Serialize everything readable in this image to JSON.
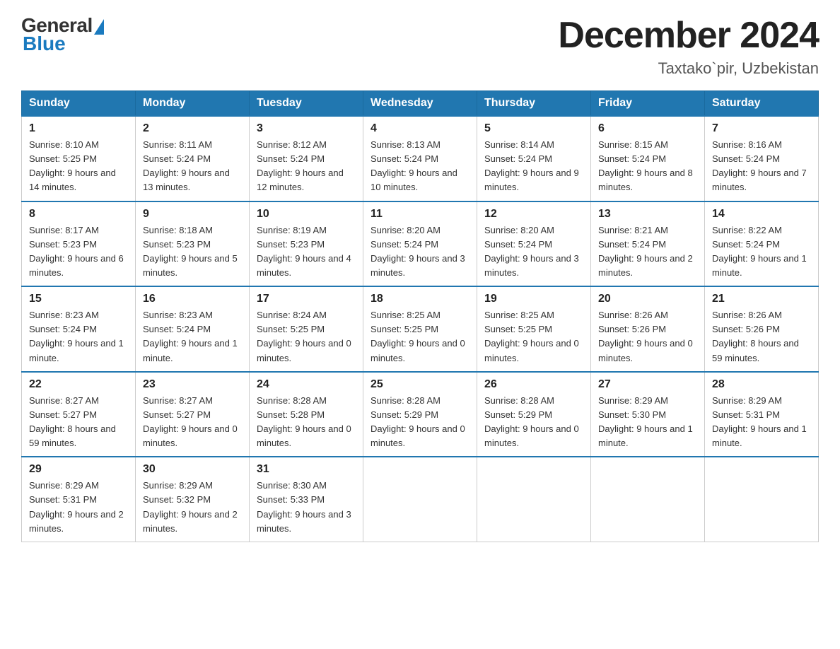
{
  "logo": {
    "general": "General",
    "blue": "Blue"
  },
  "title": "December 2024",
  "location": "Taxtako`pir, Uzbekistan",
  "days_of_week": [
    "Sunday",
    "Monday",
    "Tuesday",
    "Wednesday",
    "Thursday",
    "Friday",
    "Saturday"
  ],
  "weeks": [
    [
      {
        "day": "1",
        "sunrise": "8:10 AM",
        "sunset": "5:25 PM",
        "daylight": "9 hours and 14 minutes."
      },
      {
        "day": "2",
        "sunrise": "8:11 AM",
        "sunset": "5:24 PM",
        "daylight": "9 hours and 13 minutes."
      },
      {
        "day": "3",
        "sunrise": "8:12 AM",
        "sunset": "5:24 PM",
        "daylight": "9 hours and 12 minutes."
      },
      {
        "day": "4",
        "sunrise": "8:13 AM",
        "sunset": "5:24 PM",
        "daylight": "9 hours and 10 minutes."
      },
      {
        "day": "5",
        "sunrise": "8:14 AM",
        "sunset": "5:24 PM",
        "daylight": "9 hours and 9 minutes."
      },
      {
        "day": "6",
        "sunrise": "8:15 AM",
        "sunset": "5:24 PM",
        "daylight": "9 hours and 8 minutes."
      },
      {
        "day": "7",
        "sunrise": "8:16 AM",
        "sunset": "5:24 PM",
        "daylight": "9 hours and 7 minutes."
      }
    ],
    [
      {
        "day": "8",
        "sunrise": "8:17 AM",
        "sunset": "5:23 PM",
        "daylight": "9 hours and 6 minutes."
      },
      {
        "day": "9",
        "sunrise": "8:18 AM",
        "sunset": "5:23 PM",
        "daylight": "9 hours and 5 minutes."
      },
      {
        "day": "10",
        "sunrise": "8:19 AM",
        "sunset": "5:23 PM",
        "daylight": "9 hours and 4 minutes."
      },
      {
        "day": "11",
        "sunrise": "8:20 AM",
        "sunset": "5:24 PM",
        "daylight": "9 hours and 3 minutes."
      },
      {
        "day": "12",
        "sunrise": "8:20 AM",
        "sunset": "5:24 PM",
        "daylight": "9 hours and 3 minutes."
      },
      {
        "day": "13",
        "sunrise": "8:21 AM",
        "sunset": "5:24 PM",
        "daylight": "9 hours and 2 minutes."
      },
      {
        "day": "14",
        "sunrise": "8:22 AM",
        "sunset": "5:24 PM",
        "daylight": "9 hours and 1 minute."
      }
    ],
    [
      {
        "day": "15",
        "sunrise": "8:23 AM",
        "sunset": "5:24 PM",
        "daylight": "9 hours and 1 minute."
      },
      {
        "day": "16",
        "sunrise": "8:23 AM",
        "sunset": "5:24 PM",
        "daylight": "9 hours and 1 minute."
      },
      {
        "day": "17",
        "sunrise": "8:24 AM",
        "sunset": "5:25 PM",
        "daylight": "9 hours and 0 minutes."
      },
      {
        "day": "18",
        "sunrise": "8:25 AM",
        "sunset": "5:25 PM",
        "daylight": "9 hours and 0 minutes."
      },
      {
        "day": "19",
        "sunrise": "8:25 AM",
        "sunset": "5:25 PM",
        "daylight": "9 hours and 0 minutes."
      },
      {
        "day": "20",
        "sunrise": "8:26 AM",
        "sunset": "5:26 PM",
        "daylight": "9 hours and 0 minutes."
      },
      {
        "day": "21",
        "sunrise": "8:26 AM",
        "sunset": "5:26 PM",
        "daylight": "8 hours and 59 minutes."
      }
    ],
    [
      {
        "day": "22",
        "sunrise": "8:27 AM",
        "sunset": "5:27 PM",
        "daylight": "8 hours and 59 minutes."
      },
      {
        "day": "23",
        "sunrise": "8:27 AM",
        "sunset": "5:27 PM",
        "daylight": "9 hours and 0 minutes."
      },
      {
        "day": "24",
        "sunrise": "8:28 AM",
        "sunset": "5:28 PM",
        "daylight": "9 hours and 0 minutes."
      },
      {
        "day": "25",
        "sunrise": "8:28 AM",
        "sunset": "5:29 PM",
        "daylight": "9 hours and 0 minutes."
      },
      {
        "day": "26",
        "sunrise": "8:28 AM",
        "sunset": "5:29 PM",
        "daylight": "9 hours and 0 minutes."
      },
      {
        "day": "27",
        "sunrise": "8:29 AM",
        "sunset": "5:30 PM",
        "daylight": "9 hours and 1 minute."
      },
      {
        "day": "28",
        "sunrise": "8:29 AM",
        "sunset": "5:31 PM",
        "daylight": "9 hours and 1 minute."
      }
    ],
    [
      {
        "day": "29",
        "sunrise": "8:29 AM",
        "sunset": "5:31 PM",
        "daylight": "9 hours and 2 minutes."
      },
      {
        "day": "30",
        "sunrise": "8:29 AM",
        "sunset": "5:32 PM",
        "daylight": "9 hours and 2 minutes."
      },
      {
        "day": "31",
        "sunrise": "8:30 AM",
        "sunset": "5:33 PM",
        "daylight": "9 hours and 3 minutes."
      },
      null,
      null,
      null,
      null
    ]
  ]
}
